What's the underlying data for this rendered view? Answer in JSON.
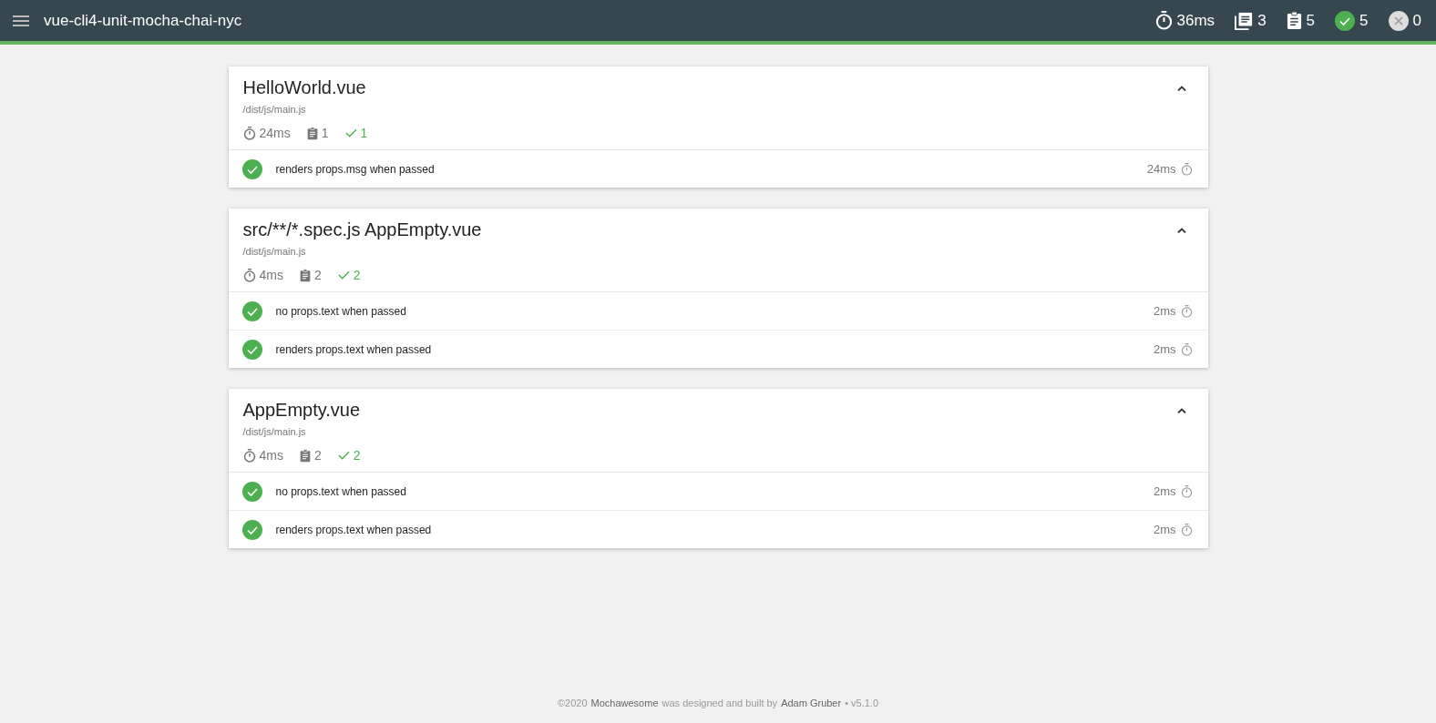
{
  "header": {
    "title": "vue-cli4-unit-mocha-chai-nyc",
    "stats": [
      {
        "kind": "duration",
        "value": "36ms"
      },
      {
        "kind": "suites",
        "value": "3"
      },
      {
        "kind": "tests",
        "value": "5"
      },
      {
        "kind": "passed",
        "value": "5"
      },
      {
        "kind": "failed",
        "value": "0"
      }
    ]
  },
  "suites": [
    {
      "title": "HelloWorld.vue",
      "file": "/dist/js/main.js",
      "expanded": true,
      "duration": "24ms",
      "tests_count": "1",
      "passed_count": "1",
      "tests": [
        {
          "title": "renders props.msg when passed",
          "passed": true,
          "duration": "24ms"
        }
      ]
    },
    {
      "title": "src/**/*.spec.js AppEmpty.vue",
      "file": "/dist/js/main.js",
      "expanded": true,
      "duration": "4ms",
      "tests_count": "2",
      "passed_count": "2",
      "tests": [
        {
          "title": "no props.text when passed",
          "passed": true,
          "duration": "2ms"
        },
        {
          "title": "renders props.text when passed",
          "passed": true,
          "duration": "2ms"
        }
      ]
    },
    {
      "title": "AppEmpty.vue",
      "file": "/dist/js/main.js",
      "expanded": true,
      "duration": "4ms",
      "tests_count": "2",
      "passed_count": "2",
      "tests": [
        {
          "title": "no props.text when passed",
          "passed": true,
          "duration": "2ms"
        },
        {
          "title": "renders props.text when passed",
          "passed": true,
          "duration": "2ms"
        }
      ]
    }
  ],
  "footer": {
    "before": "©2020",
    "brand": "Mochawesome",
    "middle": "was designed and built by",
    "author": "Adam Gruber",
    "version": "• v5.1.0"
  }
}
